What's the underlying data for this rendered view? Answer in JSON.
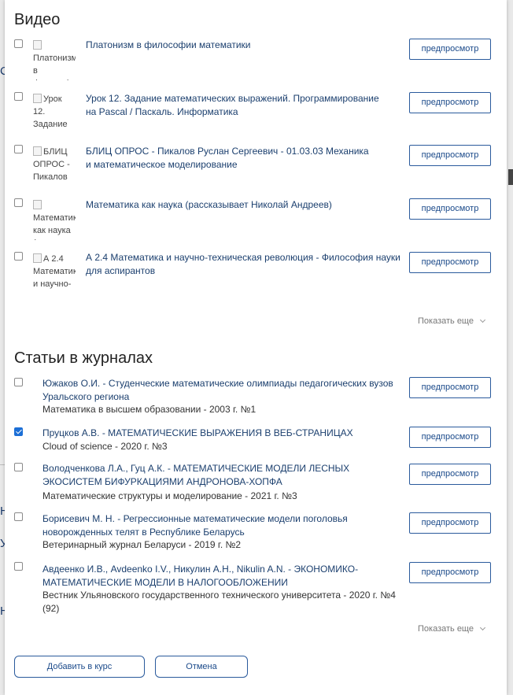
{
  "background": {
    "fragments": [
      "С",
      "Н",
      "У",
      "Н"
    ]
  },
  "videos": {
    "heading": "Видео",
    "items": [
      {
        "thumb_alt": "Платонизм в философии",
        "title": "Платонизм в философии математики",
        "checked": false
      },
      {
        "thumb_alt": "Урок 12. Задание",
        "title": "Урок 12. Задание математических выражений. Программирование на Pascal / Паскаль. Информатика",
        "checked": false
      },
      {
        "thumb_alt": "БЛИЦ ОПРОС - Пикалов",
        "title": "БЛИЦ ОПРОС - Пикалов Руслан Сергеевич - 01.03.03 Механика и математическое моделирование",
        "checked": false
      },
      {
        "thumb_alt": "Математика как наука (расскаже",
        "title": "Математика как наука (рассказывает Николай Андреев)",
        "checked": false
      },
      {
        "thumb_alt": "А 2.4 Математика и научно-",
        "title": "А 2.4 Математика и научно-техническая революция - Философия науки для аспирантов",
        "checked": false
      }
    ],
    "preview_label": "предпросмотр",
    "show_more": "Показать еще"
  },
  "articles": {
    "heading": "Статьи в журналах",
    "items": [
      {
        "title": "Южаков О.И. - Студенческие математические олимпиады педагогических вузов Уральского региона",
        "source": "Математика в высшем образовании - 2003 г. №1",
        "checked": false
      },
      {
        "title": "Пруцков А.В. - МАТЕМАТИЧЕСКИЕ ВЫРАЖЕНИЯ В ВЕБ-СТРАНИЦАХ",
        "source": "Cloud of science - 2020 г. №3",
        "checked": true
      },
      {
        "title": "Володченкова Л.А., Гуц А.К. - МАТЕМАТИЧЕСКИЕ МОДЕЛИ ЛЕСНЫХ ЭКОСИСТЕМ БИФУРКАЦИЯМИ АНДРОНОВА-ХОПФА",
        "source": "Математические структуры и моделирование - 2021 г. №3",
        "checked": false
      },
      {
        "title": "Борисевич М. Н. - Регрессионные математические модели поголовья новорожденных телят в Республике Беларусь",
        "source": "Ветеринарный журнал Беларуси - 2019 г. №2",
        "checked": false
      },
      {
        "title": "Авдеенко И.В., Avdeenko I.V., Никулин А.Н., Nikulin A.N. - ЭКОНОМИКО-МАТЕМАТИЧЕСКИЕ МОДЕЛИ В НАЛОГООБЛОЖЕНИИ",
        "source": "Вестник Ульяновского государственного технического университета - 2020 г. №4 (92)",
        "checked": false
      }
    ],
    "preview_label": "предпросмотр",
    "show_more": "Показать еще"
  },
  "footer": {
    "add_label": "Добавить в курс",
    "cancel_label": "Отмена"
  }
}
